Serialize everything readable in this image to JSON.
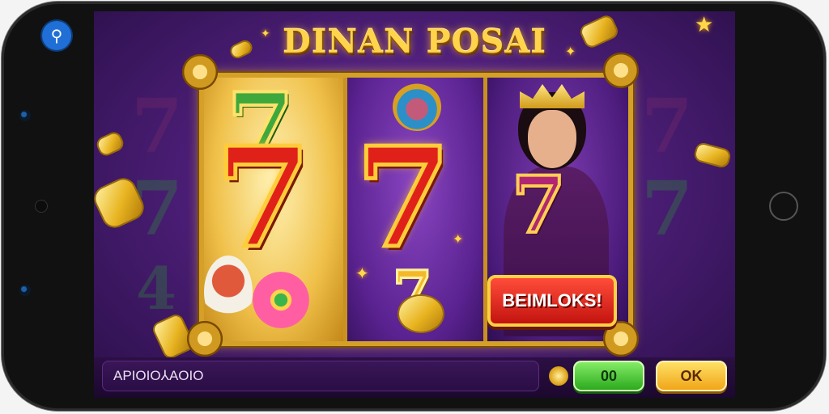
{
  "app_badge_icon": "person-icon",
  "game": {
    "title": "DINAN POSAI",
    "reels": [
      {
        "symbol": "7",
        "color": "red",
        "extras": [
          "green-7",
          "warrior-character",
          "flower"
        ]
      },
      {
        "symbol": "7",
        "color": "red",
        "extras": [
          "jester-character",
          "small-gold-7",
          "coin"
        ]
      },
      {
        "symbol": "7",
        "color": "purple",
        "extras": [
          "queen-character"
        ]
      }
    ],
    "banner_label": "BEIMLOKS!"
  },
  "bottom_bar": {
    "balance_text": "APIOIO⅄AOIO",
    "green_button_label": "00",
    "yellow_button_label": "OK"
  },
  "colors": {
    "background_purple": "#4e1f7a",
    "gold": "#d4a028",
    "seven_red": "#e0211a",
    "green_button": "#27a51a",
    "yellow_button": "#f0a214"
  }
}
